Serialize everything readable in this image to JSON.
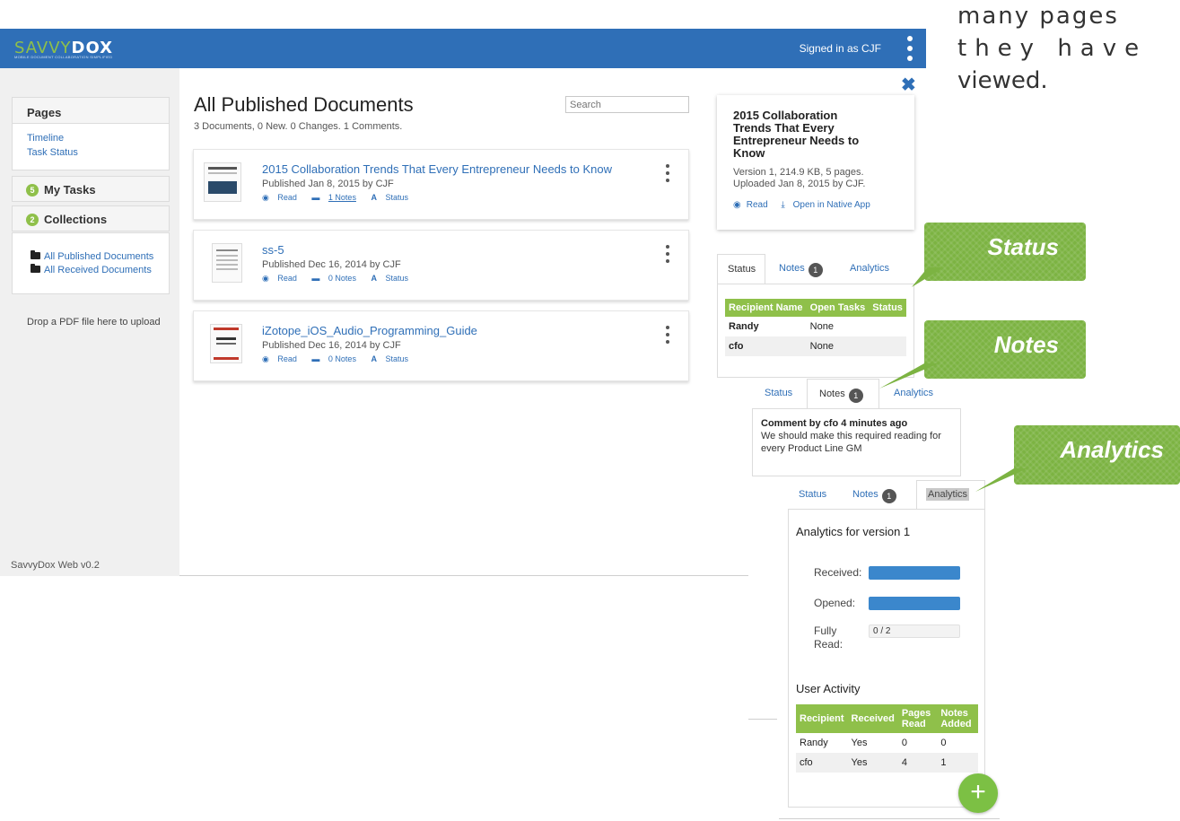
{
  "app": {
    "logo": {
      "part1": "SAVVY",
      "part2": "DOX",
      "tagline": "MOBILE DOCUMENT COLLABORATION SIMPLIFIED"
    },
    "signed_in": "Signed in as CJF",
    "version": "SavvyDox Web v0.2"
  },
  "caption": {
    "line1": "many pages",
    "line2": "they have",
    "line3": "viewed."
  },
  "sidebar": {
    "pages_title": "Pages",
    "pages_links": [
      "Timeline",
      "Task Status"
    ],
    "my_tasks": {
      "count": "5",
      "label": "My Tasks"
    },
    "collections": {
      "count": "2",
      "label": "Collections"
    },
    "collection_links": [
      "All Published Documents",
      "All Received Documents"
    ],
    "drop_hint": "Drop a PDF file here to upload"
  },
  "main": {
    "title": "All Published Documents",
    "summary": "3 Documents, 0 New. 0 Changes. 1 Comments.",
    "search_placeholder": "Search",
    "documents": [
      {
        "title": "2015 Collaboration Trends That Every Entrepreneur Needs to Know",
        "published": "Published Jan 8, 2015 by CJF",
        "read": "Read",
        "notes": "1 Notes",
        "status": "Status"
      },
      {
        "title": "ss-5",
        "published": "Published Dec 16, 2014 by CJF",
        "read": "Read",
        "notes": "0 Notes",
        "status": "Status"
      },
      {
        "title": "iZotope_iOS_Audio_Programming_Guide",
        "published": "Published Dec 16, 2014 by CJF",
        "read": "Read",
        "notes": "0 Notes",
        "status": "Status"
      }
    ]
  },
  "info": {
    "title": "2015 Collaboration Trends That Every Entrepreneur Needs to Know",
    "meta1": "Version 1, 214.9 KB, 5 pages.",
    "meta2": "Uploaded Jan 8, 2015 by CJF.",
    "read": "Read",
    "open_native": "Open in Native App"
  },
  "tabs": {
    "status": "Status",
    "notes": "Notes",
    "notes_count": "1",
    "analytics": "Analytics"
  },
  "status_table": {
    "headers": [
      "Recipient Name",
      "Open Tasks",
      "Status"
    ],
    "rows": [
      [
        "Randy",
        "None",
        ""
      ],
      [
        "cfo",
        "None",
        ""
      ]
    ]
  },
  "notes_panel": {
    "comment_head": "Comment by cfo 4 minutes ago",
    "comment_body": "We should make this required reading for every Product Line GM"
  },
  "analytics_panel": {
    "title": "Analytics for version 1",
    "received_label": "Received:",
    "opened_label": "Opened:",
    "fully_label1": "Fully",
    "fully_label2": "Read:",
    "received_fraction": 1.0,
    "opened_fraction": 1.0,
    "fully_read_value": "0 / 2",
    "user_activity": "User Activity",
    "headers": [
      "Recipient",
      "Received",
      "Pages Read",
      "Notes Added"
    ],
    "rows": [
      [
        "Randy",
        "Yes",
        "0",
        "0"
      ],
      [
        "cfo",
        "Yes",
        "4",
        "1"
      ]
    ]
  },
  "callouts": {
    "status": "Status",
    "notes": "Notes",
    "analytics": "Analytics"
  },
  "colors": {
    "header": "#2f6fb7",
    "accent_green": "#8fc04a",
    "link_blue": "#2f6fb7",
    "bar_blue": "#3b87cc"
  }
}
